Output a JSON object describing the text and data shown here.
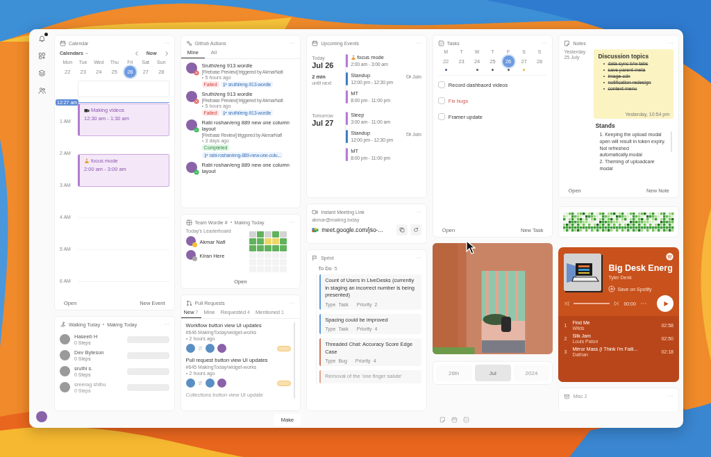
{
  "sidebar": {
    "notification": true
  },
  "calendar": {
    "title": "Calendar",
    "calendars_label": "Calendars",
    "now_label": "Now",
    "days": [
      {
        "weekday": "Mon",
        "date": "22",
        "selected": false
      },
      {
        "weekday": "Tue",
        "date": "23",
        "selected": false
      },
      {
        "weekday": "Wed",
        "date": "24",
        "selected": false
      },
      {
        "weekday": "Thu",
        "date": "25",
        "selected": false
      },
      {
        "weekday": "Fri",
        "date": "26",
        "selected": true
      },
      {
        "weekday": "Sat",
        "date": "27",
        "selected": false
      },
      {
        "weekday": "Sun",
        "date": "28",
        "selected": false
      }
    ],
    "now_time": "12:27 am",
    "hours": [
      "1 AM",
      "2 AM",
      "3 AM",
      "4 AM",
      "5 AM",
      "6 AM"
    ],
    "events": [
      {
        "kind": "recording",
        "title": "Making videos",
        "time": "12:30 am - 1:30 am"
      },
      {
        "kind": "focus",
        "title": "focus mode",
        "time": "2:00 am - 3:00 am"
      }
    ],
    "open": "Open",
    "new": "New Event"
  },
  "walking": {
    "title": "Walking Today",
    "team": "Making Today",
    "people": [
      {
        "name": "Haseeb H",
        "steps": "0 Steps"
      },
      {
        "name": "Dev Byteson",
        "steps": "0 Steps"
      },
      {
        "name": "sruthi s.",
        "steps": "0 Steps"
      },
      {
        "name": "sreerag shibu",
        "steps": "0 Steps"
      }
    ]
  },
  "github": {
    "title": "Github Actions",
    "tabs": [
      {
        "label": "Mine",
        "selected": true
      },
      {
        "label": "All",
        "selected": false
      }
    ],
    "runs": [
      {
        "kind": "failed",
        "title": "Sruthi/eng 913 wordle",
        "source": "[Firebase Preview] triggered by AkmarNafi",
        "time": "5 hours ago",
        "status": "Failed",
        "branch": "sruthi/eng-913-wordle"
      },
      {
        "kind": "failed",
        "title": "Sruthi/eng 913 wordle",
        "source": "[Firebase Preview] triggered by AkmarNafi",
        "time": "5 hours ago",
        "status": "Failed",
        "branch": "sruthi/eng-913-wordle"
      },
      {
        "kind": "completed",
        "title": "Rabi roshan/eng 889 new one column layout",
        "source": "[Firebase Review] triggered by AkmarNafi",
        "time": "3 days ago",
        "status": "Completed",
        "branch": "rabi-roshan/eng-889-new-one-colu..."
      },
      {
        "kind": "completed",
        "title": "Rabi roshan/eng 889 new one column layout"
      }
    ]
  },
  "wordle": {
    "title": "Team Wordle #",
    "team": "Making Today",
    "subtitle": "Today's Leaderboard",
    "players": [
      {
        "name": "Akmar Nafi",
        "color": "#f2c230"
      },
      {
        "name": "Kiran Here",
        "color": "#a8a8a8"
      }
    ],
    "grid": [
      [
        {
          "color": "#d4d4d4"
        },
        {
          "color": "#62b25d"
        },
        {
          "color": "#d4d4d4"
        },
        {
          "color": "#62b25d"
        },
        {
          "color": "#d4d4d4"
        }
      ],
      [
        {
          "color": "#62b25d"
        },
        {
          "color": "#62b25d"
        },
        {
          "color": "#ecd868"
        },
        {
          "color": "#ecd868"
        },
        {
          "color": "#62b25d"
        }
      ],
      [
        {
          "color": "#62b25d"
        },
        {
          "color": "#62b25d"
        },
        {
          "color": "#62b25d"
        },
        {
          "color": "#62b25d"
        },
        {
          "color": "#62b25d"
        }
      ],
      [
        {
          "color": "#f3f3f3"
        },
        {
          "color": "#f3f3f3"
        },
        {
          "color": "#f3f3f3"
        },
        {
          "color": "#f3f3f3"
        },
        {
          "color": "#f3f3f3"
        }
      ],
      [
        {
          "color": "#f3f3f3"
        },
        {
          "color": "#f3f3f3"
        },
        {
          "color": "#f3f3f3"
        },
        {
          "color": "#f3f3f3"
        },
        {
          "color": "#f3f3f3"
        }
      ],
      [
        {
          "color": "#f3f3f3"
        },
        {
          "color": "#f3f3f3"
        },
        {
          "color": "#f3f3f3"
        },
        {
          "color": "#f3f3f3"
        },
        {
          "color": "#f3f3f3"
        }
      ]
    ],
    "open": "Open"
  },
  "pull_requests": {
    "title": "Pull Requests",
    "tabs": [
      {
        "label": "New",
        "count": "7",
        "selected": true
      },
      {
        "label": "Mine",
        "selected": false
      },
      {
        "label": "Requested",
        "count": "4",
        "selected": false
      },
      {
        "label": "Mentioned",
        "count": "1",
        "selected": false
      }
    ],
    "items": [
      {
        "title": "Workflow button view UI updates",
        "repo": "#646 MakingToday/widget-works",
        "time": "2 hours ago"
      },
      {
        "title": "Pull request button view UI updates",
        "repo": "#645 MakingToday/widget-works",
        "time": "2 hours ago"
      },
      {
        "title": "Collections button view UI update"
      }
    ]
  },
  "upcoming": {
    "title": "Upcoming Events",
    "days": [
      {
        "label": "Today",
        "date": "Jul 26",
        "countdown": "2 min",
        "countdown_note": "until next",
        "events": [
          {
            "kind": "focus",
            "title": "focus mode",
            "time": "2:00 am - 3:00 am",
            "color": "#b57bd6"
          },
          {
            "kind": "meeting",
            "title": "Standup",
            "time": "12:00 pm - 12:30 pm",
            "color": "#3d7fc1",
            "join": "Join"
          },
          {
            "kind": "plain",
            "title": "MT",
            "time": "8:00 pm - 11:00 pm",
            "color": "#b57bd6"
          }
        ]
      },
      {
        "label": "Tomorrow",
        "date": "Jul 27",
        "events": [
          {
            "kind": "plain",
            "title": "Sleep",
            "time": "3:00 am - 11:00 am",
            "color": "#b57bd6"
          },
          {
            "kind": "meeting",
            "title": "Standup",
            "time": "12:00 pm - 12:30 pm",
            "color": "#3d7fc1",
            "join": "Join"
          },
          {
            "kind": "plain",
            "title": "MT",
            "time": "8:00 pm - 11:00 pm",
            "color": "#b57bd6"
          }
        ]
      }
    ]
  },
  "meeting": {
    "title": "Instant Meeting Link",
    "account": "akmar@making.today",
    "link": "meet.google.com/jso-..."
  },
  "sprint": {
    "title": "Sprint",
    "column": "To Do",
    "count": "5",
    "cards": [
      {
        "title": "Count of Users in LiveDesks (currently in staging an incorrect number is being presented)",
        "type_label": "Type",
        "type": "Task",
        "priority_label": "Priority",
        "priority": "2",
        "color": "#5b9bd5"
      },
      {
        "title": "Spacing could be improved",
        "type_label": "Type",
        "type": "Task",
        "priority_label": "Priority",
        "priority": "4",
        "color": "#5b9bd5"
      },
      {
        "title": "Threaded Chat: Accuracy Score Edge Case",
        "type_label": "Type",
        "type": "Bug",
        "priority_label": "Priority",
        "priority": "4",
        "color": "#c97a5e"
      },
      {
        "title": "Removal of the 'one finger salute'",
        "color": "#e0a58c"
      }
    ]
  },
  "tasks": {
    "title": "Tasks",
    "days": [
      {
        "weekday": "M",
        "date": "22",
        "selected": false,
        "color": "#4a5a7a"
      },
      {
        "weekday": "T",
        "date": "23",
        "selected": false
      },
      {
        "weekday": "W",
        "date": "24",
        "selected": false,
        "color": "#555555"
      },
      {
        "weekday": "T",
        "date": "25",
        "selected": false,
        "color": "#555555"
      },
      {
        "weekday": "F",
        "date": "26",
        "selected": true,
        "color": "#555555"
      },
      {
        "weekday": "S",
        "date": "27",
        "selected": false,
        "color": "#e3b341"
      },
      {
        "weekday": "S",
        "date": "28",
        "selected": false
      }
    ],
    "items": [
      {
        "label": "Record dashbaord videos",
        "checked": false,
        "overdue": false
      },
      {
        "label": "Fix bugs",
        "checked": false,
        "overdue": true
      },
      {
        "label": "Framer update",
        "checked": false,
        "overdue": false
      }
    ],
    "open": "Open",
    "new": "New Task"
  },
  "date": {
    "parts": [
      {
        "label": "26th",
        "selected": false
      },
      {
        "label": "Jul",
        "selected": true
      },
      {
        "label": "2024",
        "selected": false
      }
    ]
  },
  "notes": {
    "title": "Notes",
    "day": "Yesterday",
    "date": "25 July",
    "sticky": {
      "title": "Discussion topics",
      "items": [
        {
          "text": "data sync b/w tabs",
          "done": true
        },
        {
          "text": "save parent meta",
          "done": true
        },
        {
          "text": "image cdn",
          "done": true
        },
        {
          "text": "notification redesign",
          "done": true
        },
        {
          "text": "context menu",
          "done": true
        }
      ],
      "timestamp": "Yesterday, 10:54 pm"
    },
    "note": {
      "title": "Stands",
      "lines": [
        "1. Keeping the upload modal open will result in token expiry. Not refreshed automatically.modal",
        "2. Theming of uploadcare modal"
      ]
    },
    "open": "Open",
    "new": "New Note"
  },
  "music": {
    "title": "Big Desk Energ",
    "artist": "Tyler Denk",
    "save": "Save on Spotify",
    "elapsed": "00:00",
    "queue": [
      {
        "number": "1",
        "title": "Find Me",
        "artist": "Wilds",
        "duration": "02:58"
      },
      {
        "number": "2",
        "title": "Silk Jam",
        "artist": "Louis Paton",
        "duration": "02:50"
      },
      {
        "number": "3",
        "title": "Mirror Mass (I Think I'm Falli...",
        "artist": "Dathan",
        "duration": "02:18"
      }
    ]
  },
  "misc": {
    "title": "Misc 2"
  },
  "bottom_bar": {
    "label": "Make"
  }
}
